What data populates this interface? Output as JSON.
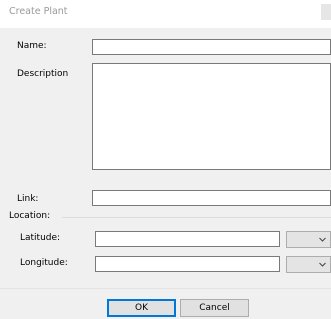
{
  "window": {
    "title": "Create Plant"
  },
  "form": {
    "name_label": "Name:",
    "name_value": "",
    "description_label": "Description",
    "description_value": "",
    "link_label": "Link:",
    "link_value": "",
    "location_label": "Location:",
    "latitude_label": "Latitude:",
    "latitude_value": "",
    "longitude_label": "Longitude:",
    "longitude_value": ""
  },
  "icons": {
    "latitude_dropdown": "chevron-down-icon",
    "longitude_dropdown": "chevron-down-icon"
  },
  "buttons": {
    "ok_label": "OK",
    "cancel_label": "Cancel"
  },
  "colors": {
    "dialog_background": "#f0f0f0",
    "default_button_border": "#0078d7"
  }
}
